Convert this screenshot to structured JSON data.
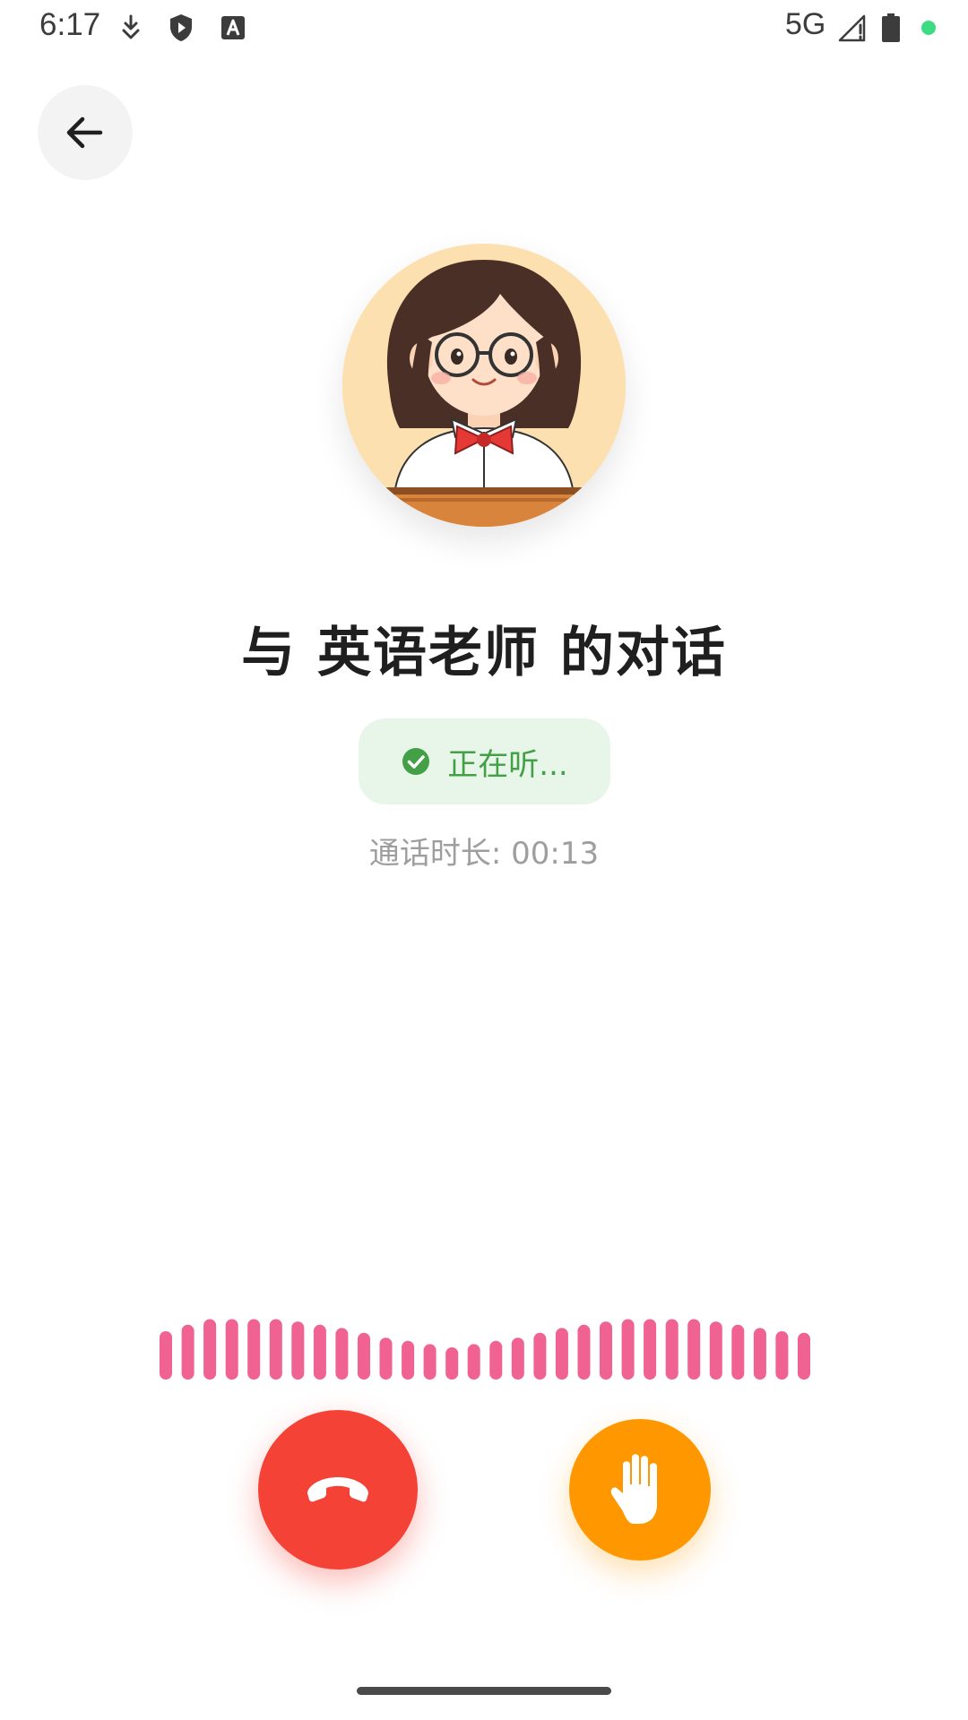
{
  "status_bar": {
    "time": "6:17",
    "network": "5G",
    "icons": [
      "download-icon",
      "shield-play-icon",
      "text-a-icon",
      "signal-icon",
      "battery-icon",
      "privacy-dot"
    ],
    "dot_color": "#3ddc84"
  },
  "header": {
    "back_icon": "arrow-left-icon"
  },
  "call": {
    "title": "与 英语老师 的对话",
    "status_text": "正在听...",
    "status_icon": "check-circle-icon",
    "duration_text": "通话时长: 00:13"
  },
  "waveform": {
    "color": "#f06292",
    "bar_levels": [
      0.6,
      0.68,
      0.75,
      0.75,
      0.75,
      0.75,
      0.72,
      0.68,
      0.64,
      0.58,
      0.52,
      0.48,
      0.44,
      0.4,
      0.44,
      0.48,
      0.52,
      0.58,
      0.64,
      0.68,
      0.72,
      0.75,
      0.75,
      0.75,
      0.75,
      0.72,
      0.68,
      0.64,
      0.6,
      0.58
    ]
  },
  "controls": {
    "hangup_icon": "phone-hangup-icon",
    "hangup_color": "#f44336",
    "interrupt_icon": "hand-raise-icon",
    "interrupt_color": "#ff9800"
  },
  "colors": {
    "title": "#1f1f1f",
    "status_green": "#43a047",
    "status_bg": "#e8f5e9",
    "muted_text": "#9e9e9e"
  }
}
